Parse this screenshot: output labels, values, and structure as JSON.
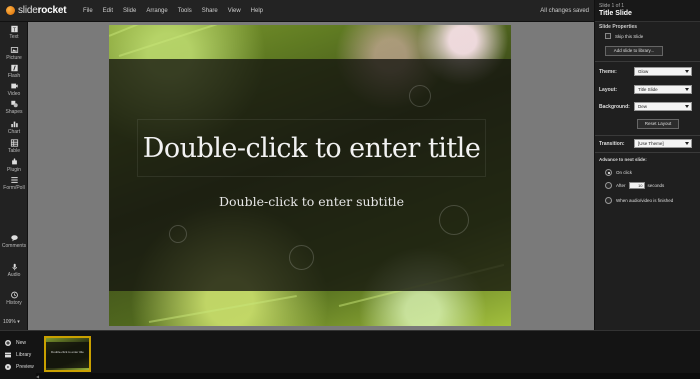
{
  "app": {
    "logo_text_light": "slide",
    "logo_text_bold": "rocket",
    "save_status": "All changes saved",
    "accent_color": "#c9a000"
  },
  "menu": [
    "File",
    "Edit",
    "Slide",
    "Arrange",
    "Tools",
    "Share",
    "View",
    "Help"
  ],
  "tools": [
    {
      "label": "Text",
      "icon": "text-icon"
    },
    {
      "label": "Picture",
      "icon": "picture-icon"
    },
    {
      "label": "Flash",
      "icon": "flash-icon"
    },
    {
      "label": "Video",
      "icon": "video-icon"
    },
    {
      "label": "Shapes",
      "icon": "shapes-icon"
    },
    {
      "label": "Chart",
      "icon": "chart-icon"
    },
    {
      "label": "Table",
      "icon": "table-icon"
    },
    {
      "label": "Plugin",
      "icon": "plugin-icon"
    },
    {
      "label": "Form/Poll",
      "icon": "form-icon"
    },
    {
      "label": "Comments",
      "icon": "comments-icon"
    },
    {
      "label": "Audio",
      "icon": "audio-icon"
    },
    {
      "label": "History",
      "icon": "history-icon"
    }
  ],
  "zoom": "109%",
  "slide": {
    "title_placeholder": "Double-click to enter title",
    "subtitle_placeholder": "Double-click to enter subtitle"
  },
  "panel": {
    "slide_counter": "Slide 1 of 1",
    "slide_name": "Title Slide",
    "properties_heading": "Slide Properties",
    "skip_label": "Skip this Slide",
    "add_library_button": "Add slide to library...",
    "theme_label": "Theme:",
    "theme_value": "Glow",
    "layout_label": "Layout:",
    "layout_value": "Title Slide",
    "background_label": "Background:",
    "background_value": "Dew",
    "reset_layout_button": "Reset Layout",
    "transition_label": "Transition:",
    "transition_value": "[Use Theme]",
    "advance_heading": "Advance to next slide:",
    "on_click_label": "On click",
    "after_label": "After",
    "after_value": "10",
    "seconds_label": "seconds",
    "when_finished_label": "When audio/video is finished"
  },
  "bottom": {
    "new_label": "New",
    "library_label": "Library",
    "preview_label": "Preview",
    "thumb_title": "Double-click to enter title"
  }
}
